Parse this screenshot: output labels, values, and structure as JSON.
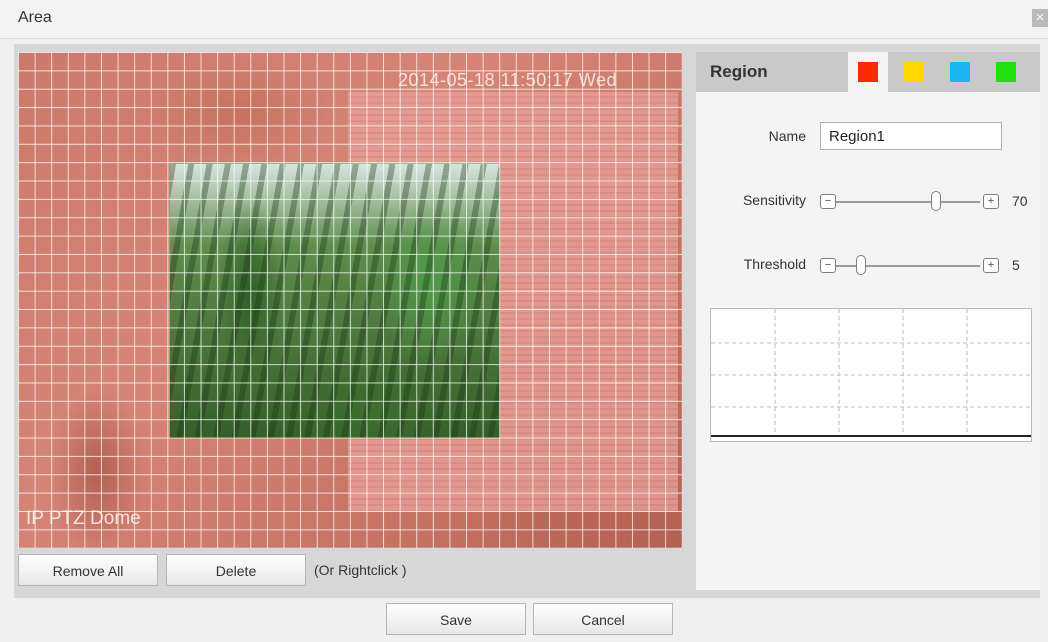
{
  "window": {
    "title": "Area",
    "close_glyph": "×"
  },
  "video": {
    "osd_time": "2014-05-18 11:50:17 Wed",
    "osd_label": "IP PTZ Dome",
    "grid_color": "#ffffff",
    "overlay_color": "#e8786e"
  },
  "actions": {
    "remove_all": "Remove All",
    "delete": "Delete",
    "hint": "(Or Rightclick )"
  },
  "footer": {
    "save": "Save",
    "cancel": "Cancel"
  },
  "region": {
    "title": "Region",
    "colors": [
      "#ff2a00",
      "#ffd700",
      "#1ab4f0",
      "#22e010"
    ],
    "name_label": "Name",
    "name_value": "Region1",
    "sensitivity": {
      "label": "Sensitivity",
      "minus": "−",
      "plus": "+",
      "value": "70"
    },
    "threshold": {
      "label": "Threshold",
      "minus": "−",
      "plus": "+",
      "value": "5"
    }
  }
}
